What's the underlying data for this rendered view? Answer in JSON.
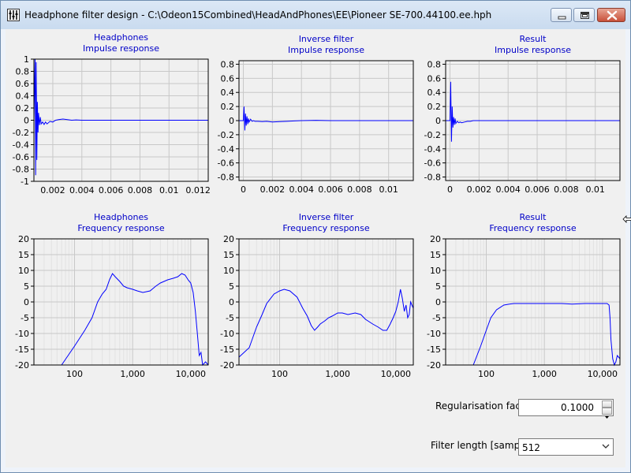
{
  "window": {
    "title": "Headphone filter design - C:\\Odeon15Combined\\HeadAndPhones\\EE\\Pioneer SE-700.44100.ee.hph"
  },
  "controls": {
    "regularisation_label": "Regularisation factor",
    "regularisation_value": "0.1000",
    "filter_length_label": "Filter length [samples]",
    "filter_length_value": "512"
  },
  "chart_data": [
    {
      "type": "line",
      "title": "Headphones",
      "subtitle": "Impulse response",
      "xlim": [
        0.0007,
        0.0127
      ],
      "ylim": [
        -1,
        1
      ],
      "xticks": [
        0.002,
        0.004,
        0.006,
        0.008,
        0.01,
        0.012
      ],
      "xticklabels": [
        "0.002",
        "0.004",
        "0.006",
        "0.008",
        "0.01",
        "0.012"
      ],
      "yticks": [
        1,
        0.8,
        0.6,
        0.4,
        0.2,
        0,
        -0.2,
        -0.4,
        -0.6,
        -0.8,
        -1
      ],
      "yticklabels": [
        "1",
        "0.8",
        "0.6",
        "0.4",
        "0.2",
        "0",
        "-0.2",
        "-0.4",
        "-0.6",
        "-0.8",
        "-1"
      ],
      "grid": true,
      "series": [
        {
          "color": "#0000ff",
          "x": [
            0.0007,
            0.00078,
            0.00082,
            0.00086,
            0.0009,
            0.00094,
            0.00098,
            0.00102,
            0.00108,
            0.00114,
            0.0012,
            0.0013,
            0.0014,
            0.0015,
            0.0016,
            0.0018,
            0.002,
            0.0022,
            0.0024,
            0.0027,
            0.003,
            0.0033,
            0.0036,
            0.004,
            0.006,
            0.008,
            0.01,
            0.0127
          ],
          "y": [
            0,
            1.0,
            -0.9,
            0.95,
            -0.65,
            0.3,
            -0.2,
            0.12,
            -0.08,
            0.05,
            -0.06,
            -0.03,
            -0.07,
            -0.03,
            -0.06,
            -0.02,
            -0.03,
            0.0,
            0.01,
            0.02,
            0.01,
            0.0,
            0.005,
            0,
            0,
            0,
            0,
            0
          ]
        }
      ]
    },
    {
      "type": "line",
      "title": "Inverse filter",
      "subtitle": "Impulse response",
      "xlim": [
        -0.0003,
        0.0117
      ],
      "ylim": [
        -0.85,
        0.85
      ],
      "xticks": [
        0,
        0.002,
        0.004,
        0.006,
        0.008,
        0.01
      ],
      "xticklabels": [
        "0",
        "0.002",
        "0.004",
        "0.006",
        "0.008",
        "0.01"
      ],
      "yticks": [
        0.8,
        0.6,
        0.4,
        0.2,
        0,
        -0.2,
        -0.4,
        -0.6,
        -0.8
      ],
      "yticklabels": [
        "0.8",
        "0.6",
        "0.4",
        "0.2",
        "0",
        "-0.2",
        "-0.4",
        "-0.6",
        "-0.8"
      ],
      "grid": true,
      "series": [
        {
          "color": "#0000ff",
          "x": [
            -0.0003,
            0.0,
            5e-05,
            0.0001,
            0.00015,
            0.0002,
            0.00025,
            0.0003,
            0.00035,
            0.0004,
            0.0005,
            0.0006,
            0.0007,
            0.0008,
            0.001,
            0.0013,
            0.0016,
            0.002,
            0.0025,
            0.003,
            0.0035,
            0.004,
            0.005,
            0.006,
            0.008,
            0.01,
            0.0117
          ],
          "y": [
            0,
            0,
            0.2,
            -0.14,
            0.1,
            -0.07,
            0.06,
            -0.05,
            0.03,
            -0.02,
            0.02,
            -0.01,
            0.0,
            -0.01,
            -0.01,
            -0.015,
            -0.01,
            -0.02,
            -0.015,
            -0.01,
            -0.005,
            0.0,
            0.005,
            0,
            0,
            0,
            0
          ]
        }
      ]
    },
    {
      "type": "line",
      "title": "Result",
      "subtitle": "Impulse response",
      "xlim": [
        -0.0003,
        0.0117
      ],
      "ylim": [
        -0.85,
        0.85
      ],
      "xticks": [
        0,
        0.002,
        0.004,
        0.006,
        0.008,
        0.01
      ],
      "xticklabels": [
        "0",
        "0.002",
        "0.004",
        "0.006",
        "0.008",
        "0.01"
      ],
      "yticks": [
        0.8,
        0.6,
        0.4,
        0.2,
        0,
        -0.2,
        -0.4,
        -0.6,
        -0.8
      ],
      "yticklabels": [
        "0.8",
        "0.6",
        "0.4",
        "0.2",
        "0",
        "-0.2",
        "-0.4",
        "-0.6",
        "-0.8"
      ],
      "grid": true,
      "series": [
        {
          "color": "#0000ff",
          "x": [
            -0.0003,
            0.0,
            5e-05,
            0.0001,
            0.00015,
            0.0002,
            0.00025,
            0.0003,
            0.00035,
            0.0004,
            0.0005,
            0.0006,
            0.0007,
            0.0008,
            0.001,
            0.0012,
            0.0014,
            0.0016,
            0.002,
            0.003,
            0.006,
            0.0117
          ],
          "y": [
            0,
            0,
            0.55,
            -0.3,
            0.2,
            -0.1,
            0.05,
            -0.06,
            0.03,
            -0.04,
            -0.01,
            -0.03,
            -0.02,
            -0.03,
            -0.02,
            -0.01,
            -0.01,
            0.0,
            0.0,
            0,
            0,
            0
          ]
        }
      ]
    },
    {
      "type": "line",
      "title": "Headphones",
      "subtitle": "Frequency response",
      "xscale": "log",
      "xlim": [
        20,
        20000
      ],
      "ylim": [
        -20,
        20
      ],
      "xticks": [
        100,
        1000,
        10000
      ],
      "xticklabels": [
        "100",
        "1,000",
        "10,000"
      ],
      "yticks": [
        20,
        15,
        10,
        5,
        0,
        -5,
        -10,
        -15,
        -20
      ],
      "yticklabels": [
        "20",
        "15",
        "10",
        "5",
        "0",
        "-5",
        "-10",
        "-15",
        "-20"
      ],
      "grid": true,
      "series": [
        {
          "color": "#0000ff",
          "x": [
            60,
            100,
            150,
            200,
            250,
            300,
            350,
            400,
            450,
            500,
            600,
            700,
            800,
            1000,
            1200,
            1500,
            2000,
            2500,
            3000,
            4000,
            5000,
            6000,
            7000,
            8000,
            9000,
            10000,
            11000,
            12000,
            13000,
            14000,
            15000,
            16000,
            18000,
            20000
          ],
          "y": [
            -20,
            -14,
            -9,
            -5,
            0,
            2.5,
            4,
            7,
            9,
            8,
            6.5,
            5,
            4.5,
            4,
            3.5,
            3,
            3.5,
            5,
            6,
            7,
            7.5,
            8,
            9,
            8.5,
            7,
            6,
            3,
            -3,
            -10,
            -17,
            -16,
            -20,
            -19,
            -20
          ]
        }
      ]
    },
    {
      "type": "line",
      "title": "Inverse filter",
      "subtitle": "Frequency response",
      "xscale": "log",
      "xlim": [
        20,
        20000
      ],
      "ylim": [
        -20,
        20
      ],
      "xticks": [
        100,
        1000,
        10000
      ],
      "xticklabels": [
        "100",
        "1,000",
        "10,000"
      ],
      "yticks": [
        20,
        15,
        10,
        5,
        0,
        -5,
        -10,
        -15,
        -20
      ],
      "yticklabels": [
        "20",
        "15",
        "10",
        "5",
        "0",
        "-5",
        "-10",
        "-15",
        "-20"
      ],
      "grid": true,
      "series": [
        {
          "color": "#0000ff",
          "x": [
            20,
            30,
            40,
            50,
            60,
            80,
            100,
            120,
            150,
            200,
            250,
            300,
            350,
            400,
            450,
            500,
            600,
            700,
            800,
            1000,
            1200,
            1500,
            2000,
            2500,
            3000,
            4000,
            5000,
            6000,
            7000,
            8000,
            9000,
            10000,
            11000,
            12000,
            13000,
            14000,
            15000,
            16000,
            17000,
            18000,
            20000
          ],
          "y": [
            -17.5,
            -14.5,
            -8,
            -4,
            -0.5,
            2.5,
            3.5,
            4,
            3.5,
            1.5,
            -2,
            -4.5,
            -7.5,
            -9,
            -8,
            -7,
            -6,
            -5,
            -4.5,
            -3.5,
            -3.5,
            -4,
            -3.5,
            -4,
            -5.5,
            -7,
            -8,
            -9,
            -9,
            -7,
            -5,
            -3,
            0,
            4,
            1,
            -3,
            -1,
            -5,
            -4,
            0,
            -2
          ]
        }
      ]
    },
    {
      "type": "line",
      "title": "Result",
      "subtitle": "Frequency response",
      "xscale": "log",
      "xlim": [
        20,
        20000
      ],
      "ylim": [
        -20,
        20
      ],
      "xticks": [
        100,
        1000,
        10000
      ],
      "xticklabels": [
        "100",
        "1,000",
        "10,000"
      ],
      "yticks": [
        20,
        15,
        10,
        5,
        0,
        -5,
        -10,
        -15,
        -20
      ],
      "yticklabels": [
        "20",
        "15",
        "10",
        "5",
        "0",
        "-5",
        "-10",
        "-15",
        "-20"
      ],
      "grid": true,
      "series": [
        {
          "color": "#0000ff",
          "x": [
            60,
            80,
            100,
            120,
            150,
            200,
            250,
            300,
            400,
            500,
            700,
            1000,
            1500,
            2000,
            3000,
            5000,
            7000,
            10000,
            12000,
            13000,
            13500,
            14000,
            15000,
            16000,
            17000,
            18000,
            20000
          ],
          "y": [
            -20,
            -14,
            -9,
            -5,
            -2.5,
            -1,
            -0.7,
            -0.5,
            -0.5,
            -0.5,
            -0.5,
            -0.5,
            -0.5,
            -0.5,
            -0.7,
            -0.5,
            -0.5,
            -0.5,
            -0.5,
            -1,
            -5,
            -12,
            -18,
            -20,
            -19,
            -17,
            -18
          ]
        }
      ]
    }
  ]
}
